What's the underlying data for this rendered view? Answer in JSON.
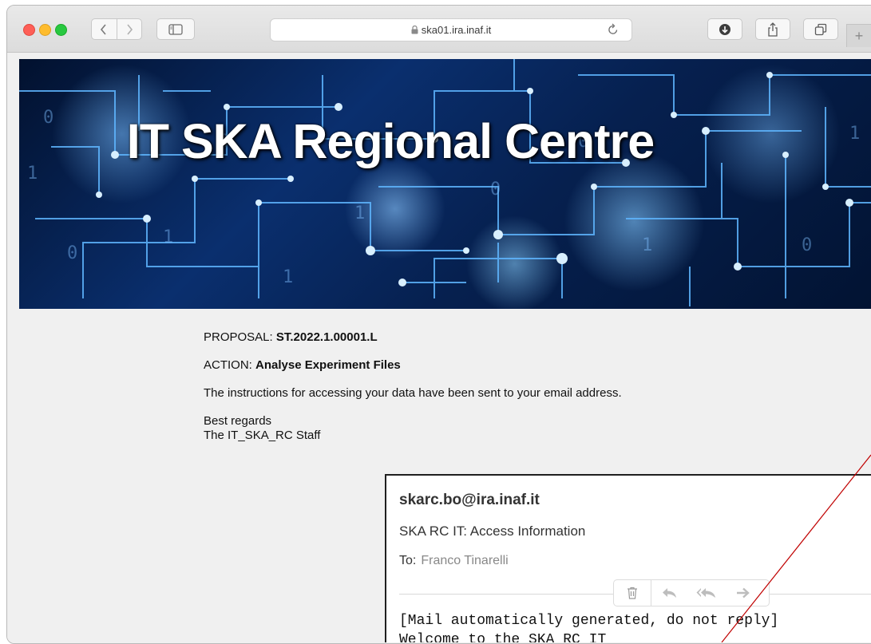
{
  "browser": {
    "url": "ska01.ira.inaf.it",
    "new_tab_glyph": "+",
    "icons": [
      "close-dot",
      "minimize-dot",
      "zoom-dot",
      "back-icon",
      "forward-icon",
      "sidebar-icon",
      "lock-icon",
      "reload-icon",
      "download-icon",
      "share-icon",
      "tabs-icon"
    ]
  },
  "page": {
    "banner_title": "IT SKA Regional Centre",
    "proposal_label": "PROPOSAL: ",
    "proposal_value": "ST.2022.1.00001.L",
    "action_label": "ACTION: ",
    "action_value": "Analyse Experiment Files",
    "instructions": "The instructions for accessing your data have been sent to your email address.",
    "regards_line1": "Best regards",
    "regards_line2": "The IT_SKA_RC Staff"
  },
  "email": {
    "from": "skarc.bo@ira.inaf.it",
    "subject": "SKA RC IT: Access Information",
    "to_label": "To:",
    "to_name": "Franco Tinarelli",
    "body_line1": "[Mail automatically generated, do not reply]",
    "body_line2": "Welcome to the SKA RC IT",
    "tools": [
      "trash-icon",
      "reply-icon",
      "reply-all-icon",
      "forward-icon"
    ]
  },
  "colors": {
    "window_bg": "#f0f0f0",
    "annotation_line": "#c00000",
    "popup_border": "#1f1f1f"
  }
}
